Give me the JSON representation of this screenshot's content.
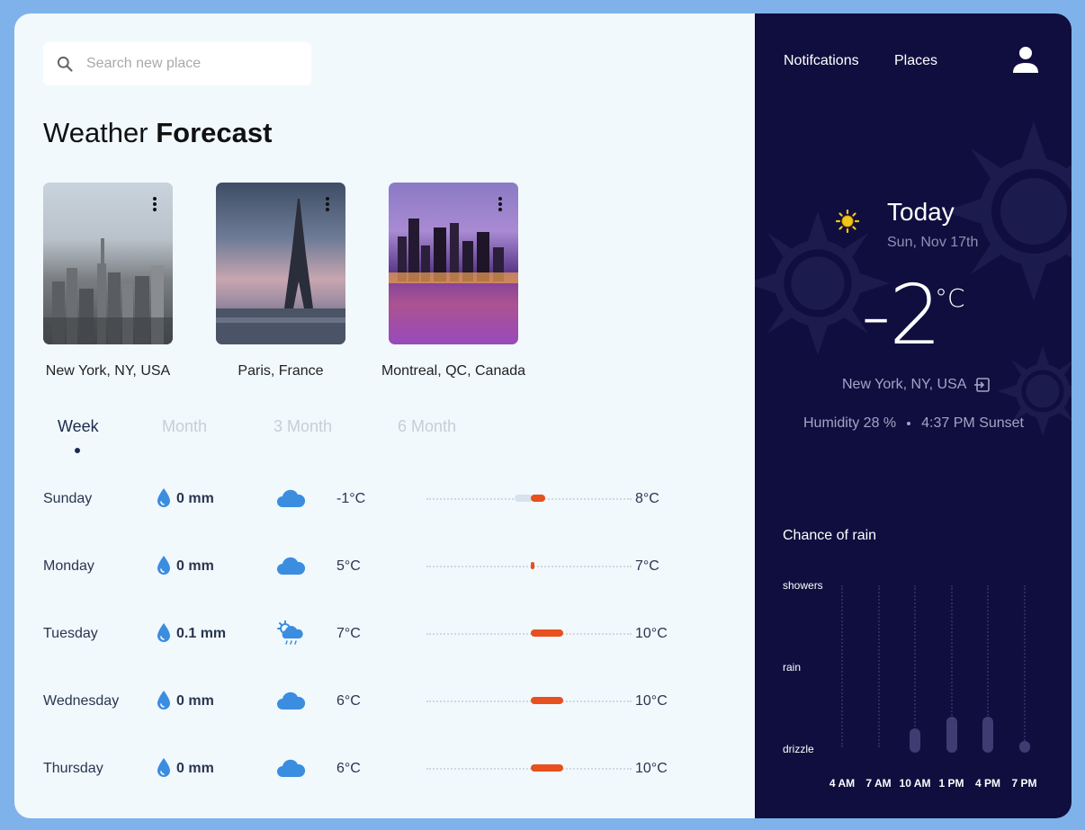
{
  "search": {
    "placeholder": "Search new place"
  },
  "title": {
    "normal": "Weather ",
    "bold": "Forecast"
  },
  "places": [
    {
      "name": "New York, NY, USA"
    },
    {
      "name": "Paris, France"
    },
    {
      "name": "Montreal, QC, Canada"
    }
  ],
  "tabs": [
    {
      "label": "Week",
      "active": true
    },
    {
      "label": "Month",
      "active": false
    },
    {
      "label": "3 Month",
      "active": false
    },
    {
      "label": "6 Month",
      "active": false
    }
  ],
  "forecast": [
    {
      "day": "Sunday",
      "precip": "0 mm",
      "icon": "cloud-icon",
      "low": "-1°C",
      "high": "8°C"
    },
    {
      "day": "Monday",
      "precip": "0 mm",
      "icon": "cloud-icon",
      "low": "5°C",
      "high": "7°C"
    },
    {
      "day": "Tuesday",
      "precip": "0.1 mm",
      "icon": "sun-rain-icon",
      "low": "7°C",
      "high": "10°C"
    },
    {
      "day": "Wednesday",
      "precip": "0 mm",
      "icon": "cloud-icon",
      "low": "6°C",
      "high": "10°C"
    },
    {
      "day": "Thursday",
      "precip": "0 mm",
      "icon": "cloud-icon",
      "low": "6°C",
      "high": "10°C"
    }
  ],
  "nav": {
    "notifications": "Notifcations",
    "places": "Places"
  },
  "today": {
    "label": "Today",
    "date": "Sun, Nov 17th",
    "temp": "-2",
    "unit": "°C",
    "location": "New York, NY, USA",
    "humidity": "Humidity 28 %",
    "sunset": "4:37 PM Sunset"
  },
  "rain": {
    "title": "Chance of rain",
    "levels": [
      "showers",
      "rain",
      "drizzle"
    ],
    "times": [
      "4 AM",
      "7 AM",
      "10 AM",
      "1 PM",
      "4 PM",
      "7 PM"
    ],
    "values": [
      0,
      0,
      0.15,
      0.22,
      0.22,
      0.07
    ]
  },
  "colors": {
    "accent": "#e8501f",
    "panel": "#100e3e",
    "drop": "#3b8de0",
    "sun": "#f5c518"
  }
}
